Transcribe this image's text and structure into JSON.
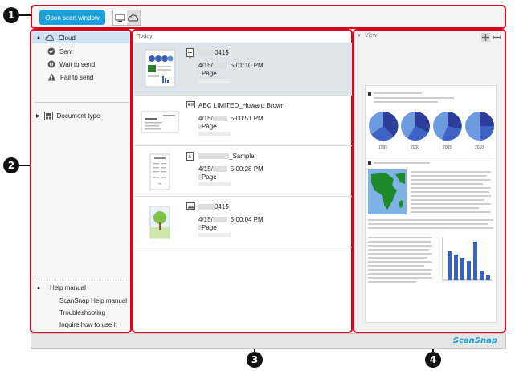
{
  "toolbar": {
    "scan_button": "Open scan window",
    "mode_icons": [
      "computer-icon",
      "cloud-icon"
    ]
  },
  "sidebar": {
    "cloud": "Cloud",
    "sent": "Sent",
    "wait": "Wait to send",
    "fail": "Fail to send",
    "doc_type": "Document type",
    "help_manual": "Help manual",
    "help_items": [
      "ScanSnap Help manual",
      "Troubleshooting",
      "Inquire how to use it"
    ]
  },
  "list": {
    "group_header": "Today",
    "rows": [
      {
        "title": "0415",
        "date": "4/15/",
        "time": "5:01:10 PM",
        "pages": "Page"
      },
      {
        "title": "ABC LIMITED_Howard Brown",
        "date": "4/15/",
        "time": "5:00:51 PM",
        "pages": "Page"
      },
      {
        "title": "_Sample",
        "date": "4/15/",
        "time": "5:00:28 PM",
        "pages": "Page"
      },
      {
        "title": "0415",
        "date": "4/15/",
        "time": "5:00:04 PM",
        "pages": "Page"
      }
    ]
  },
  "viewer": {
    "header": "View",
    "chart_years": [
      "1995",
      "2000",
      "2005",
      "2010"
    ]
  },
  "footer": {
    "brand": "ScanSnap"
  },
  "callouts": [
    "1",
    "2",
    "3",
    "4"
  ]
}
